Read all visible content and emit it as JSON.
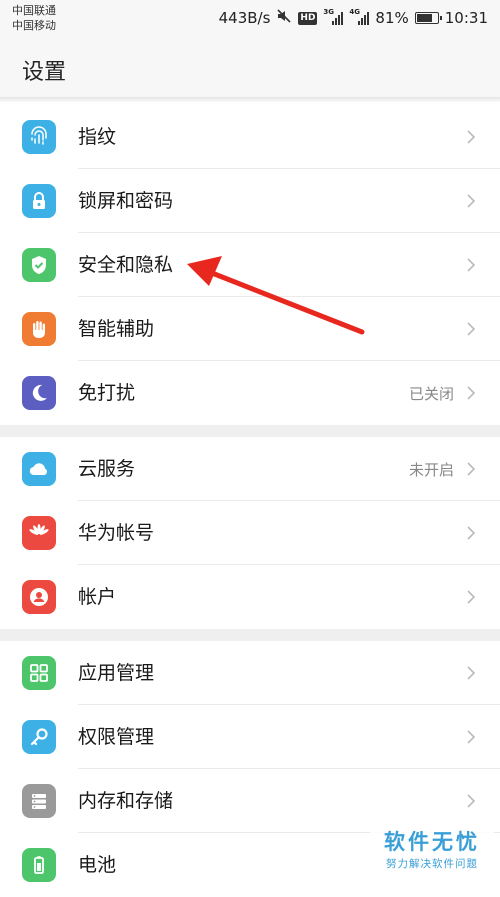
{
  "status_bar": {
    "carrier_1": "中国联通",
    "carrier_2": "中国移动",
    "speed": "443B/s",
    "hd": "HD",
    "net_1": "3G",
    "net_2": "4G",
    "battery": "81%",
    "battery_level": 0.81,
    "time": "10:31"
  },
  "header": {
    "title": "设置"
  },
  "groups": [
    {
      "items": [
        {
          "label": "指纹",
          "icon": "fingerprint-icon",
          "color": "#3db1e6"
        },
        {
          "label": "锁屏和密码",
          "icon": "lock-icon",
          "color": "#3db1e6"
        },
        {
          "label": "安全和隐私",
          "icon": "shield-icon",
          "color": "#4dc66b"
        },
        {
          "label": "智能辅助",
          "icon": "hand-icon",
          "color": "#f07b32"
        },
        {
          "label": "免打扰",
          "value": "已关闭",
          "icon": "moon-icon",
          "color": "#5d5ec2"
        }
      ]
    },
    {
      "items": [
        {
          "label": "云服务",
          "value": "未开启",
          "icon": "cloud-icon",
          "color": "#3db1e6"
        },
        {
          "label": "华为帐号",
          "icon": "huawei-logo-icon",
          "color": "#ec4a40"
        },
        {
          "label": "帐户",
          "icon": "person-icon",
          "color": "#ec4a40"
        }
      ]
    },
    {
      "items": [
        {
          "label": "应用管理",
          "icon": "apps-grid-icon",
          "color": "#4dc66b"
        },
        {
          "label": "权限管理",
          "icon": "key-icon",
          "color": "#3db1e6"
        },
        {
          "label": "内存和存储",
          "icon": "storage-icon",
          "color": "#9a9a9a"
        },
        {
          "label": "电池",
          "icon": "battery-icon",
          "color": "#4dc66b"
        }
      ]
    }
  ],
  "watermark": {
    "title": "软件无忧",
    "subtitle": "努力解决软件问题"
  }
}
